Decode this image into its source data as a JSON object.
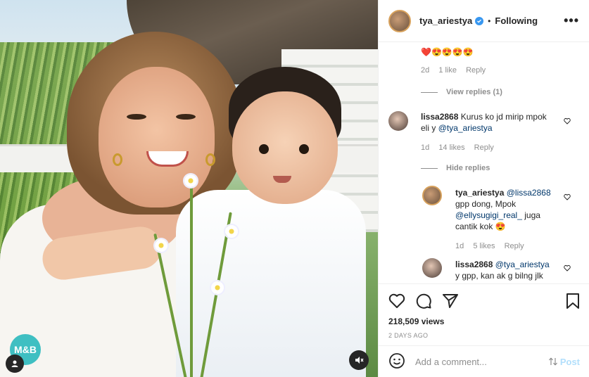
{
  "header": {
    "username": "tya_ariestya",
    "separator": "•",
    "following_label": "Following",
    "more_label": "•••"
  },
  "comments": {
    "top_emojis": "❤️😍😍😍😍",
    "first_meta": {
      "age": "2d",
      "likes": "1 like",
      "reply": "Reply"
    },
    "view_replies": "View replies (1)",
    "c1": {
      "user": "lissa2868",
      "text_a": " Kurus ko jd mirip mpok",
      "text_b": "eli y ",
      "mention": "@tya_ariestya",
      "age": "1d",
      "likes": "14 likes",
      "reply": "Reply"
    },
    "hide_replies": "Hide replies",
    "c2": {
      "user": "tya_ariestya",
      "mention1": "@lissa2868",
      "text_a": "gpp dong, Mpok",
      "mention2": "@ellysugigi_real_",
      "text_b": " juga",
      "text_c": "cantik kok 😍",
      "age": "1d",
      "likes": "5 likes",
      "reply": "Reply"
    },
    "c3": {
      "user": "lissa2868",
      "mention": "@tya_ariestya",
      "text_a": "y gpp, kan ak g bilng jlk"
    }
  },
  "actions": {
    "likes_count": "218,509 views",
    "date": "2 DAYS AGO"
  },
  "comment_bar": {
    "placeholder": "Add a comment...",
    "post_label": "Post"
  },
  "photo": {
    "logo_text": "M&B"
  },
  "colors": {
    "link": "#00376b",
    "muted": "#8e8e8e",
    "verified": "#3897f0",
    "post_disabled": "#b2dffc"
  }
}
